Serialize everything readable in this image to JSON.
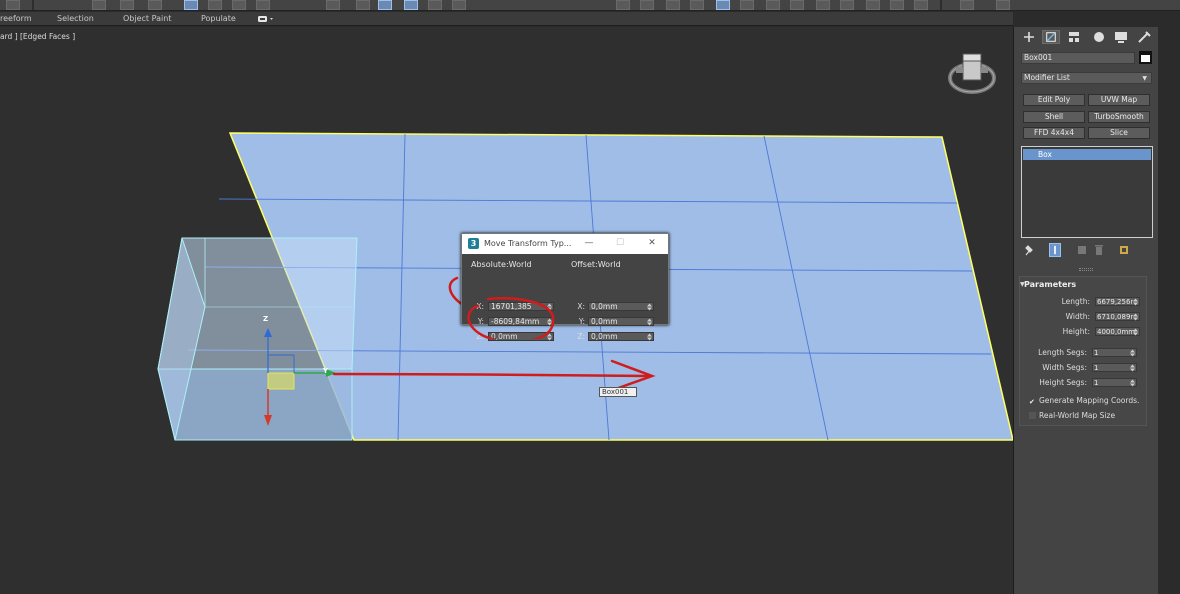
{
  "ribbon": {
    "tabs": [
      "reeform",
      "Selection",
      "Object Paint",
      "Populate"
    ]
  },
  "viewport": {
    "label": "ard ] [Edged Faces ]",
    "tooltip": "Box001",
    "gizmo_axes": [
      "Z",
      "Y"
    ]
  },
  "move_dialog": {
    "title": "Move Transform Typ...",
    "app_icon": "3",
    "buttons": {
      "minimize": "—",
      "maximize": "☐",
      "close": "✕"
    },
    "absolute": {
      "title": "Absolute:World",
      "x_label": "X:",
      "x_value": "16701,385",
      "y_label": "Y:",
      "y_value": "-8609,84mm",
      "z_label": "Z:",
      "z_value": "0,0mm"
    },
    "offset": {
      "title": "Offset:World",
      "x_label": "X:",
      "x_value": "0,0mm",
      "y_label": "Y:",
      "y_value": "0,0mm",
      "z_label": "Z:",
      "z_value": "0,0mm"
    }
  },
  "command_panel": {
    "tabs": [
      "create-icon",
      "modify-icon",
      "hierarchy-icon",
      "motion-icon",
      "display-icon",
      "utilities-icon"
    ],
    "active_tab": "modify-icon",
    "object_name": "Box001",
    "object_color": "#ffffff",
    "modifier_list": "Modifier List",
    "modifier_buttons": [
      "Edit Poly",
      "UVW Map",
      "Shell",
      "TurboSmooth",
      "FFD 4x4x4",
      "Slice"
    ],
    "stack_items": [
      "Box"
    ],
    "parameters": {
      "title": "Parameters",
      "length_label": "Length:",
      "length_value": "6679,256r",
      "width_label": "Width:",
      "width_value": "6710,089r",
      "height_label": "Height:",
      "height_value": "4000,0mm",
      "length_segs_label": "Length Segs:",
      "length_segs_value": "1",
      "width_segs_label": "Width Segs:",
      "width_segs_value": "1",
      "height_segs_label": "Height Segs:",
      "height_segs_value": "1",
      "gen_mapping_label": "Generate Mapping Coords.",
      "gen_mapping_checked": "✔",
      "real_world_label": "Real-World Map Size"
    }
  },
  "colors": {
    "selection": "#6a94cc",
    "plane_fill": "#9fbde6",
    "plane_grid": "#4d79d8",
    "plane_edge": "#ffff66",
    "annotation": "#d01c1c"
  }
}
